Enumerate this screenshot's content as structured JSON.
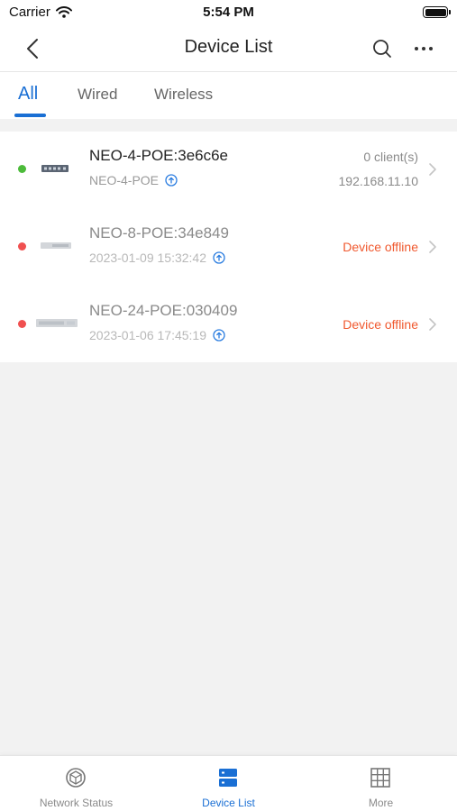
{
  "status_bar": {
    "carrier": "Carrier",
    "time": "5:54 PM"
  },
  "header": {
    "title": "Device List",
    "back_icon": "chevron-left-icon",
    "search_icon": "search-icon",
    "more_icon": "ellipsis-icon"
  },
  "tabs": [
    {
      "label": "All",
      "active": true
    },
    {
      "label": "Wired",
      "active": false
    },
    {
      "label": "Wireless",
      "active": false
    }
  ],
  "devices": [
    {
      "name": "NEO-4-POE:3e6c6e",
      "subtitle": "NEO-4-POE",
      "status": "online",
      "right_top": "0 client(s)",
      "right_bottom": "192.168.11.10"
    },
    {
      "name": "NEO-8-POE:34e849",
      "subtitle": "2023-01-09 15:32:42",
      "status": "offline",
      "status_text": "Device offline"
    },
    {
      "name": "NEO-24-POE:030409",
      "subtitle": "2023-01-06 17:45:19",
      "status": "offline",
      "status_text": "Device offline"
    }
  ],
  "bottom_nav": [
    {
      "label": "Network Status",
      "icon": "network-status-icon",
      "active": false
    },
    {
      "label": "Device List",
      "icon": "device-list-icon",
      "active": true
    },
    {
      "label": "More",
      "icon": "grid-icon",
      "active": false
    }
  ],
  "colors": {
    "accent": "#1a6fd4",
    "online": "#4cbb3a",
    "offline": "#f05050",
    "offline_text": "#f0582e"
  }
}
